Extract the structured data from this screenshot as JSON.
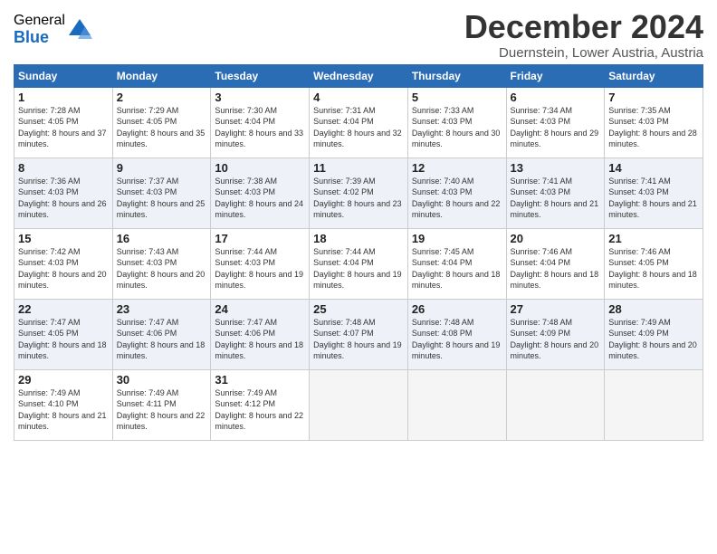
{
  "logo": {
    "general": "General",
    "blue": "Blue"
  },
  "title": "December 2024",
  "location": "Duernstein, Lower Austria, Austria",
  "weekdays": [
    "Sunday",
    "Monday",
    "Tuesday",
    "Wednesday",
    "Thursday",
    "Friday",
    "Saturday"
  ],
  "weeks": [
    [
      {
        "day": "1",
        "sunrise": "Sunrise: 7:28 AM",
        "sunset": "Sunset: 4:05 PM",
        "daylight": "Daylight: 8 hours and 37 minutes."
      },
      {
        "day": "2",
        "sunrise": "Sunrise: 7:29 AM",
        "sunset": "Sunset: 4:05 PM",
        "daylight": "Daylight: 8 hours and 35 minutes."
      },
      {
        "day": "3",
        "sunrise": "Sunrise: 7:30 AM",
        "sunset": "Sunset: 4:04 PM",
        "daylight": "Daylight: 8 hours and 33 minutes."
      },
      {
        "day": "4",
        "sunrise": "Sunrise: 7:31 AM",
        "sunset": "Sunset: 4:04 PM",
        "daylight": "Daylight: 8 hours and 32 minutes."
      },
      {
        "day": "5",
        "sunrise": "Sunrise: 7:33 AM",
        "sunset": "Sunset: 4:03 PM",
        "daylight": "Daylight: 8 hours and 30 minutes."
      },
      {
        "day": "6",
        "sunrise": "Sunrise: 7:34 AM",
        "sunset": "Sunset: 4:03 PM",
        "daylight": "Daylight: 8 hours and 29 minutes."
      },
      {
        "day": "7",
        "sunrise": "Sunrise: 7:35 AM",
        "sunset": "Sunset: 4:03 PM",
        "daylight": "Daylight: 8 hours and 28 minutes."
      }
    ],
    [
      {
        "day": "8",
        "sunrise": "Sunrise: 7:36 AM",
        "sunset": "Sunset: 4:03 PM",
        "daylight": "Daylight: 8 hours and 26 minutes."
      },
      {
        "day": "9",
        "sunrise": "Sunrise: 7:37 AM",
        "sunset": "Sunset: 4:03 PM",
        "daylight": "Daylight: 8 hours and 25 minutes."
      },
      {
        "day": "10",
        "sunrise": "Sunrise: 7:38 AM",
        "sunset": "Sunset: 4:03 PM",
        "daylight": "Daylight: 8 hours and 24 minutes."
      },
      {
        "day": "11",
        "sunrise": "Sunrise: 7:39 AM",
        "sunset": "Sunset: 4:02 PM",
        "daylight": "Daylight: 8 hours and 23 minutes."
      },
      {
        "day": "12",
        "sunrise": "Sunrise: 7:40 AM",
        "sunset": "Sunset: 4:03 PM",
        "daylight": "Daylight: 8 hours and 22 minutes."
      },
      {
        "day": "13",
        "sunrise": "Sunrise: 7:41 AM",
        "sunset": "Sunset: 4:03 PM",
        "daylight": "Daylight: 8 hours and 21 minutes."
      },
      {
        "day": "14",
        "sunrise": "Sunrise: 7:41 AM",
        "sunset": "Sunset: 4:03 PM",
        "daylight": "Daylight: 8 hours and 21 minutes."
      }
    ],
    [
      {
        "day": "15",
        "sunrise": "Sunrise: 7:42 AM",
        "sunset": "Sunset: 4:03 PM",
        "daylight": "Daylight: 8 hours and 20 minutes."
      },
      {
        "day": "16",
        "sunrise": "Sunrise: 7:43 AM",
        "sunset": "Sunset: 4:03 PM",
        "daylight": "Daylight: 8 hours and 20 minutes."
      },
      {
        "day": "17",
        "sunrise": "Sunrise: 7:44 AM",
        "sunset": "Sunset: 4:03 PM",
        "daylight": "Daylight: 8 hours and 19 minutes."
      },
      {
        "day": "18",
        "sunrise": "Sunrise: 7:44 AM",
        "sunset": "Sunset: 4:04 PM",
        "daylight": "Daylight: 8 hours and 19 minutes."
      },
      {
        "day": "19",
        "sunrise": "Sunrise: 7:45 AM",
        "sunset": "Sunset: 4:04 PM",
        "daylight": "Daylight: 8 hours and 18 minutes."
      },
      {
        "day": "20",
        "sunrise": "Sunrise: 7:46 AM",
        "sunset": "Sunset: 4:04 PM",
        "daylight": "Daylight: 8 hours and 18 minutes."
      },
      {
        "day": "21",
        "sunrise": "Sunrise: 7:46 AM",
        "sunset": "Sunset: 4:05 PM",
        "daylight": "Daylight: 8 hours and 18 minutes."
      }
    ],
    [
      {
        "day": "22",
        "sunrise": "Sunrise: 7:47 AM",
        "sunset": "Sunset: 4:05 PM",
        "daylight": "Daylight: 8 hours and 18 minutes."
      },
      {
        "day": "23",
        "sunrise": "Sunrise: 7:47 AM",
        "sunset": "Sunset: 4:06 PM",
        "daylight": "Daylight: 8 hours and 18 minutes."
      },
      {
        "day": "24",
        "sunrise": "Sunrise: 7:47 AM",
        "sunset": "Sunset: 4:06 PM",
        "daylight": "Daylight: 8 hours and 18 minutes."
      },
      {
        "day": "25",
        "sunrise": "Sunrise: 7:48 AM",
        "sunset": "Sunset: 4:07 PM",
        "daylight": "Daylight: 8 hours and 19 minutes."
      },
      {
        "day": "26",
        "sunrise": "Sunrise: 7:48 AM",
        "sunset": "Sunset: 4:08 PM",
        "daylight": "Daylight: 8 hours and 19 minutes."
      },
      {
        "day": "27",
        "sunrise": "Sunrise: 7:48 AM",
        "sunset": "Sunset: 4:09 PM",
        "daylight": "Daylight: 8 hours and 20 minutes."
      },
      {
        "day": "28",
        "sunrise": "Sunrise: 7:49 AM",
        "sunset": "Sunset: 4:09 PM",
        "daylight": "Daylight: 8 hours and 20 minutes."
      }
    ],
    [
      {
        "day": "29",
        "sunrise": "Sunrise: 7:49 AM",
        "sunset": "Sunset: 4:10 PM",
        "daylight": "Daylight: 8 hours and 21 minutes."
      },
      {
        "day": "30",
        "sunrise": "Sunrise: 7:49 AM",
        "sunset": "Sunset: 4:11 PM",
        "daylight": "Daylight: 8 hours and 22 minutes."
      },
      {
        "day": "31",
        "sunrise": "Sunrise: 7:49 AM",
        "sunset": "Sunset: 4:12 PM",
        "daylight": "Daylight: 8 hours and 22 minutes."
      },
      null,
      null,
      null,
      null
    ]
  ]
}
